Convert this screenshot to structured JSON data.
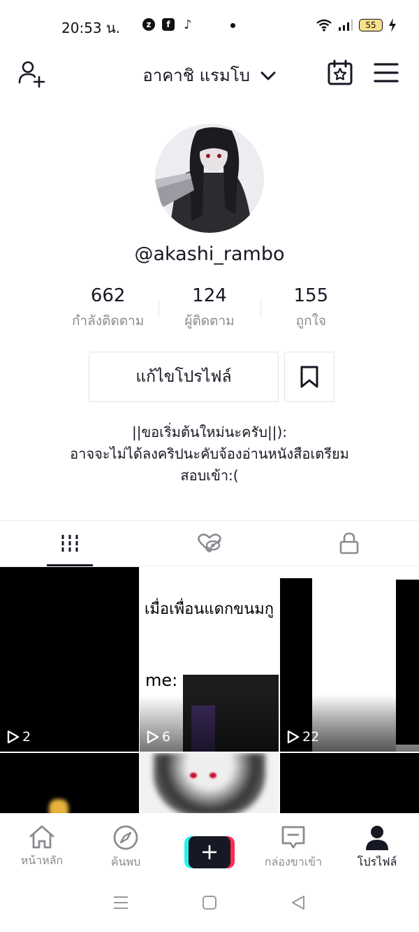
{
  "status_bar": {
    "time": "20:53 น.",
    "battery": "55"
  },
  "header": {
    "title": "อาคาชิ แรมโบ"
  },
  "profile": {
    "username": "@akashi_rambo",
    "stats": [
      {
        "value": "662",
        "label": "กำลังติดตาม"
      },
      {
        "value": "124",
        "label": "ผู้ติดตาม"
      },
      {
        "value": "155",
        "label": "ถูกใจ"
      }
    ],
    "edit_button": "แก้ไขโปรไฟล์",
    "bio_lines": [
      "||ขอเริ่มต้นใหม่นะครับ||):",
      "อาจจะไม่ได้ลงคริปนะคับจ้องอ่านหนังสือเตรียม",
      "สอบเข้า:("
    ]
  },
  "videos": [
    {
      "views": "2"
    },
    {
      "views": "6",
      "caption_top": "เมื่อเพื่อนแดกขนมกู",
      "caption_me": "me:"
    },
    {
      "views": "22"
    }
  ],
  "bottom_nav": [
    {
      "label": "หน้าหลัก",
      "icon": "home-icon"
    },
    {
      "label": "ค้นพบ",
      "icon": "compass-icon"
    },
    {
      "label": "",
      "icon": "plus-icon"
    },
    {
      "label": "กล่องขาเข้า",
      "icon": "inbox-icon"
    },
    {
      "label": "โปรไฟล์",
      "icon": "profile-icon",
      "active": true
    }
  ],
  "colors": {
    "text": "#161823",
    "muted": "#8a8b91",
    "border": "#e3e3e4",
    "accent_cyan": "#25f4ee",
    "accent_red": "#fe2c55"
  }
}
